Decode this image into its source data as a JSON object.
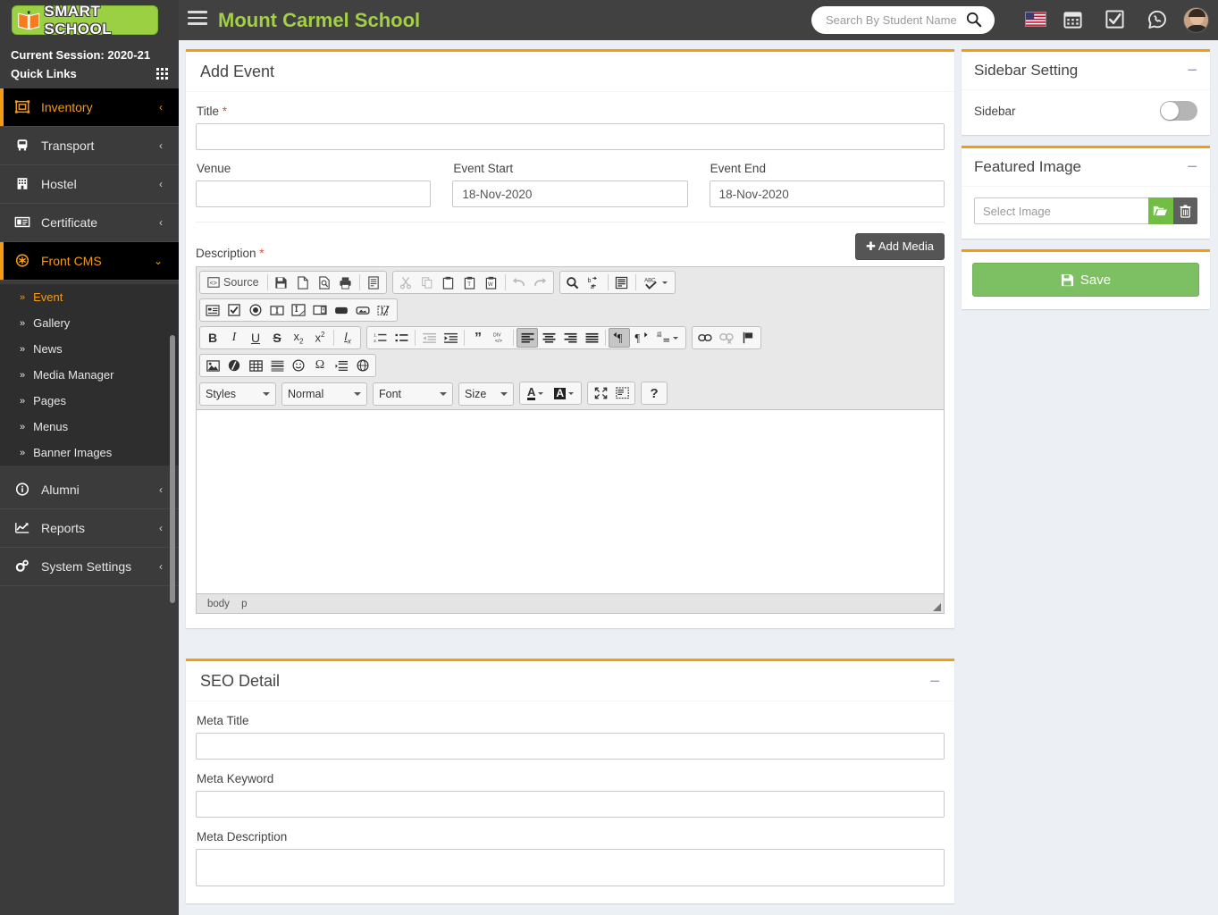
{
  "header": {
    "logo_text": "SMART SCHOOL",
    "school_title": "Mount Carmel School",
    "menu_toggle": "hamburger-icon",
    "search_placeholder": "Search By Student Name",
    "search_value": "",
    "icons": [
      "us-flag-icon",
      "calendar-icon",
      "checkbox-icon",
      "whatsapp-icon",
      "avatar"
    ]
  },
  "sidebar": {
    "session": "Current Session: 2020-21",
    "quick_links": "Quick Links",
    "items": [
      {
        "label": "Inventory",
        "icon": "inventory-icon",
        "arrow": "‹",
        "active": true
      },
      {
        "label": "Transport",
        "icon": "bus-icon",
        "arrow": "‹",
        "active": false
      },
      {
        "label": "Hostel",
        "icon": "hostel-icon",
        "arrow": "‹",
        "active": false
      },
      {
        "label": "Certificate",
        "icon": "certificate-icon",
        "arrow": "‹",
        "active": false
      },
      {
        "label": "Front CMS",
        "icon": "front-cms-icon",
        "arrow": "⌄",
        "active": true
      }
    ],
    "sub_items": [
      {
        "label": "Event",
        "active": true
      },
      {
        "label": "Gallery",
        "active": false
      },
      {
        "label": "News",
        "active": false
      },
      {
        "label": "Media Manager",
        "active": false
      },
      {
        "label": "Pages",
        "active": false
      },
      {
        "label": "Menus",
        "active": false
      },
      {
        "label": "Banner Images",
        "active": false
      }
    ],
    "items_bottom": [
      {
        "label": "Alumni",
        "icon": "info-icon",
        "arrow": "‹"
      },
      {
        "label": "Reports",
        "icon": "chart-icon",
        "arrow": "‹"
      },
      {
        "label": "System Settings",
        "icon": "gears-icon",
        "arrow": "‹"
      }
    ]
  },
  "event_panel": {
    "title": "Add Event",
    "title_label": "Title",
    "title_required": "*",
    "title_value": "",
    "venue_label": "Venue",
    "venue_value": "",
    "event_start_label": "Event Start",
    "event_start_value": "18-Nov-2020",
    "event_end_label": "Event End",
    "event_end_value": "18-Nov-2020",
    "description_label": "Description",
    "description_required": "*",
    "add_media_label": "Add Media"
  },
  "editor": {
    "row1": {
      "source_label": "Source",
      "group1": [
        "source-icon",
        "Source"
      ],
      "group2": [
        "save-icon",
        "new-page-icon",
        "preview-icon",
        "print-icon",
        "templates-icon"
      ],
      "group3": [
        "cut-icon",
        "copy-icon",
        "paste-icon",
        "paste-text-icon",
        "paste-word-icon",
        "undo-icon",
        "redo-icon"
      ],
      "group4": [
        "find-icon",
        "replace-icon",
        "select-all-icon",
        "spellcheck-icon"
      ]
    },
    "row2": [
      "form-icon",
      "checkbox-icon",
      "radio-icon",
      "text-field-icon",
      "textarea-icon",
      "select-icon",
      "button-icon",
      "image-button-icon",
      "hidden-field-icon"
    ],
    "row3": {
      "group1": [
        "bold-icon",
        "italic-icon",
        "underline-icon",
        "strike-icon",
        "subscript-icon",
        "superscript-icon",
        "remove-format-icon"
      ],
      "group2": [
        "numbered-list-icon",
        "bulleted-list-icon",
        "outdent-icon",
        "indent-icon",
        "blockquote-icon",
        "div-icon",
        "align-left-icon",
        "align-center-icon",
        "align-right-icon",
        "justify-icon",
        "ltr-icon",
        "rtl-icon",
        "language-icon"
      ],
      "group3": [
        "link-icon",
        "unlink-icon",
        "anchor-icon"
      ]
    },
    "row4": [
      "image-icon",
      "flash-icon",
      "table-icon",
      "hrule-icon",
      "smiley-icon",
      "special-char-icon",
      "page-break-icon",
      "iframe-icon"
    ],
    "selects": [
      {
        "name": "styles-select",
        "label": "Styles"
      },
      {
        "name": "format-select",
        "label": "Normal"
      },
      {
        "name": "font-select",
        "label": "Font"
      },
      {
        "name": "size-select",
        "label": "Size"
      }
    ],
    "color_buttons": [
      "text-color-icon",
      "background-color-icon"
    ],
    "tools": [
      "maximize-icon",
      "show-blocks-icon",
      "about-icon"
    ],
    "help_label": "?",
    "content": "",
    "breadcrumb": [
      "body",
      "p"
    ]
  },
  "seo_panel": {
    "title": "SEO Detail",
    "meta_title_label": "Meta Title",
    "meta_title_value": "",
    "meta_keyword_label": "Meta Keyword",
    "meta_keyword_value": "",
    "meta_description_label": "Meta Description",
    "meta_description_value": ""
  },
  "right": {
    "sidebar_setting": {
      "title": "Sidebar Setting",
      "label": "Sidebar",
      "enabled": false
    },
    "featured_image": {
      "title": "Featured Image",
      "placeholder": "Select Image",
      "value": "",
      "browse_icon": "folder-open-icon",
      "delete_icon": "trash-icon"
    },
    "save_label": "Save"
  },
  "colors": {
    "accent": "#f39c12",
    "brand_green": "#9bd043",
    "title_green": "#a2cf46",
    "sidebar_dark": "#3b3b3b",
    "sidebar_active": "#000000",
    "save_green": "#7dc063",
    "browse_green": "#72bd44",
    "required_red": "#dd4b39",
    "page_bg": "#ecf0f5"
  }
}
